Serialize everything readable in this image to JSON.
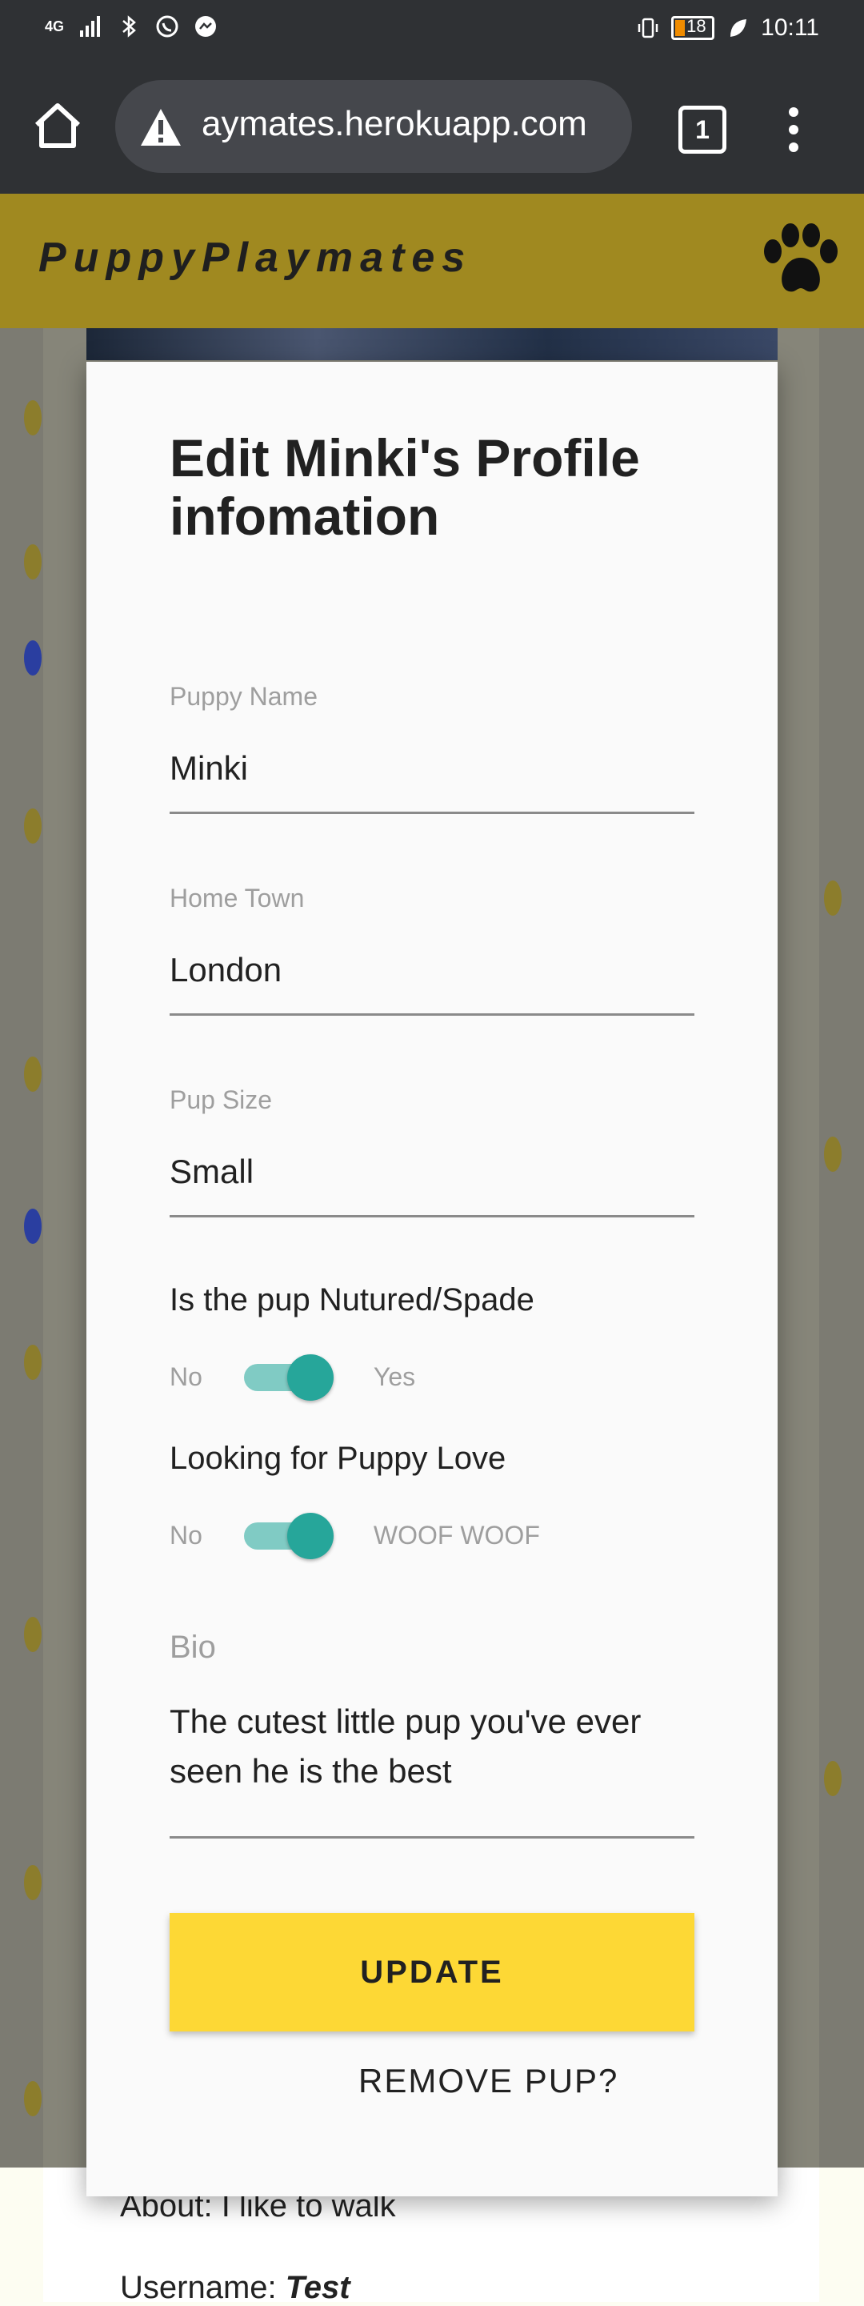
{
  "status_bar": {
    "network": "4G",
    "battery": "18",
    "time": "10:11"
  },
  "browser": {
    "url": "aymates.herokuapp.com",
    "tab_count": "1"
  },
  "app": {
    "brand": "PuppyPlaymates"
  },
  "modal": {
    "title": "Edit Minki's Profile infomation",
    "fields": [
      {
        "label": "Puppy Name",
        "value": "Minki"
      },
      {
        "label": "Home Town",
        "value": "London"
      },
      {
        "label": "Pup Size",
        "value": "Small"
      }
    ],
    "toggles": [
      {
        "question": "Is the pup Nutured/Spade",
        "off_label": "No",
        "on_label": "Yes",
        "state": "on"
      },
      {
        "question": "Looking for Puppy Love",
        "off_label": "No",
        "on_label": "WOOF WOOF",
        "state": "on"
      }
    ],
    "bio_label": "Bio",
    "bio_value": "The cutest little pup you've ever seen he is the best",
    "update_label": "UPDATE",
    "remove_label": "REMOVE PUP?"
  },
  "background": {
    "about_label": "About:",
    "about_value": "I like to walk",
    "username_label": "Username:",
    "username_value": "Test"
  },
  "colors": {
    "header": "#a08920",
    "toggle_on": "#26a69a",
    "update_button": "#fdd835"
  }
}
